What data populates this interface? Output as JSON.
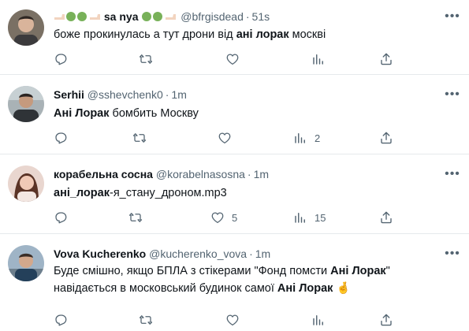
{
  "tweets": [
    {
      "name": "sa nya",
      "handle": "@bfrgisdead",
      "separator": "·",
      "time": "51s",
      "text_pre": "боже прокинулась а тут дрони від ",
      "text_bold": "ані лорак",
      "text_post": " москві",
      "reply_count": "",
      "retweet_count": "",
      "like_count": "",
      "views_count": ""
    },
    {
      "name": "Serhii",
      "handle": "@sshevchenk0",
      "separator": "·",
      "time": "1m",
      "text_bold": "Ані Лорак",
      "text_post": " бомбить Москву",
      "reply_count": "",
      "retweet_count": "",
      "like_count": "",
      "views_count": "2"
    },
    {
      "name": "корабельна сосна",
      "handle": "@korabelnasosna",
      "separator": "·",
      "time": "1m",
      "text_bold": "ані_лорак",
      "text_post": "-я_стану_дроном.mp3",
      "reply_count": "",
      "retweet_count": "",
      "like_count": "5",
      "views_count": "15"
    },
    {
      "name": "Vova Kucherenko",
      "handle": "@kucherenko_vova",
      "separator": "·",
      "time": "1m",
      "line1_pre": "Буде смішно, якщо БПЛА з стікерами \"Фонд помсти ",
      "line1_bold": "Ані Лорак",
      "line1_post": "\"",
      "line2_pre": "навідається в московський будинок самої ",
      "line2_bold": "Ані Лорак",
      "line2_emoji": "🤞",
      "reply_count": "",
      "retweet_count": "",
      "like_count": "",
      "views_count": ""
    }
  ],
  "icons": {
    "more": "more-horizontal-icon",
    "reply": "reply-icon",
    "retweet": "retweet-icon",
    "like": "like-icon",
    "views": "views-icon",
    "share": "share-icon"
  },
  "colors": {
    "text": "#0f1419",
    "secondary": "#536471",
    "divider": "#e6e9ec",
    "name_emoji_green": "#78b159"
  }
}
